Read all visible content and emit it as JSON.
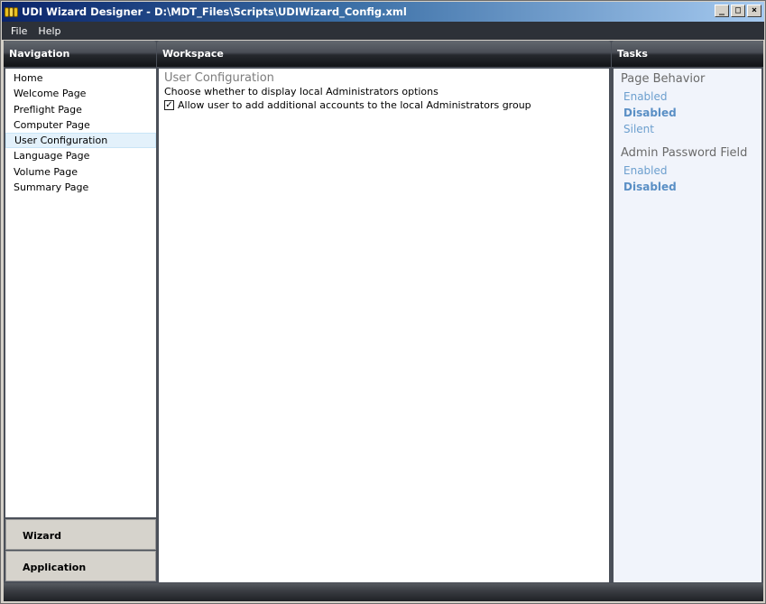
{
  "window": {
    "title": "UDI Wizard Designer - D:\\MDT_Files\\Scripts\\UDIWizard_Config.xml",
    "buttons": {
      "minimize": "_",
      "maximize": "□",
      "close": "×"
    }
  },
  "menu": {
    "items": [
      "File",
      "Help"
    ]
  },
  "navigation": {
    "header": "Navigation",
    "items": [
      "Home",
      "Welcome Page",
      "Preflight Page",
      "Computer Page",
      "User Configuration",
      "Language Page",
      "Volume Page",
      "Summary Page"
    ],
    "selected": "User Configuration",
    "buttons": {
      "wizard": "Wizard",
      "application": "Application"
    }
  },
  "workspace": {
    "header": "Workspace",
    "title": "User Configuration",
    "description": "Choose whether to display local Administrators options",
    "checkbox_label": "Allow user to add additional accounts to the local Administrators group",
    "checkbox_checked": true,
    "checkbox_mark": "✓"
  },
  "tasks": {
    "header": "Tasks",
    "groups": [
      {
        "title": "Page Behavior",
        "links": [
          "Enabled",
          "Disabled",
          "Silent"
        ],
        "active": "Disabled"
      },
      {
        "title": "Admin Password Field",
        "links": [
          "Enabled",
          "Disabled"
        ],
        "active": "Disabled"
      }
    ]
  },
  "colors": {
    "title_bar_start": "#0a246a",
    "menu_bar": "#2d3138",
    "panel_bg": "#4b5059",
    "task_link": "#6c9fce",
    "selected_row": "#e3f1fb"
  }
}
